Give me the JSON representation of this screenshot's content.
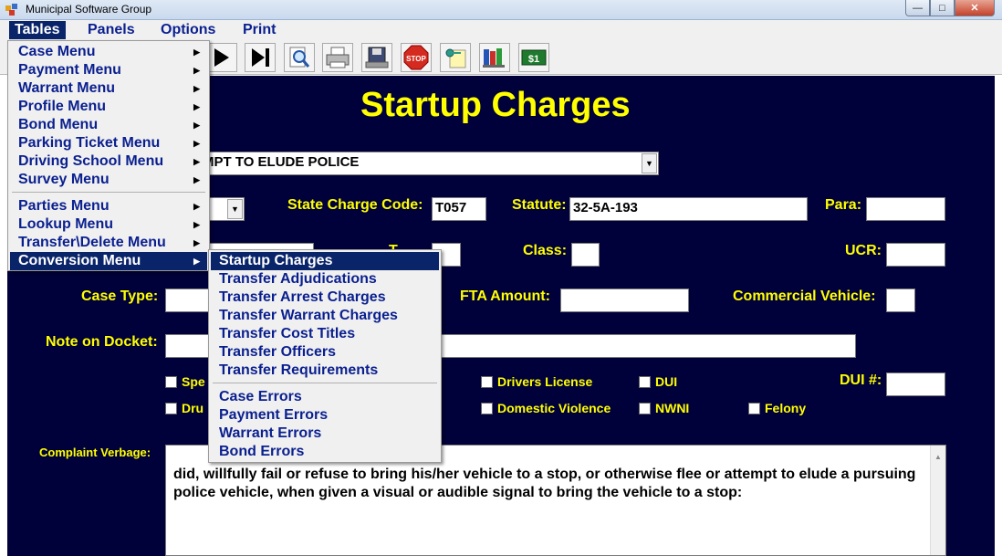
{
  "window": {
    "title": "Municipal Software Group"
  },
  "menubar": {
    "items": [
      "Tables",
      "Panels",
      "Options",
      "Print"
    ]
  },
  "form": {
    "heading": "Startup Charges",
    "charge_desc_value": "MPT TO ELUDE POLICE",
    "state_charge_code_label": "State Charge Code:",
    "state_charge_code_value": "T057",
    "statute_label": "Statute:",
    "statute_value": "32-5A-193",
    "para_label": "Para:",
    "t_label": "T",
    "class_label": "Class:",
    "ucr_label": "UCR:",
    "case_type_label": "Case Type:",
    "fta_amount_label": "FTA Amount:",
    "commercial_vehicle_label": "Commercial Vehicle:",
    "note_on_docket_label": "Note on Docket:",
    "spe_label": "Spe",
    "dru_label": "Dru",
    "drivers_license_label": "Drivers License",
    "dui_label": "DUI",
    "dui_num_label": "DUI #:",
    "domestic_violence_label": "Domestic Violence",
    "nwni_label": "NWNI",
    "felony_label": "Felony",
    "complaint_verbage_label": "Complaint Verbage:",
    "complaint_verbage_value": "did, willfully fail or refuse to bring his/her vehicle to a stop, or otherwise flee or attempt to elude a pursuing police vehicle, when given a visual or audible signal to bring the vehicle to a stop:"
  },
  "tables_menu": {
    "items": [
      "Case Menu",
      "Payment Menu",
      "Warrant Menu",
      "Profile Menu",
      "Bond Menu",
      "Parking Ticket Menu",
      "Driving School Menu",
      "Survey Menu",
      "Parties Menu",
      "Lookup Menu",
      "Transfer\\Delete Menu",
      "Conversion Menu"
    ]
  },
  "conversion_menu": {
    "items": [
      "Startup Charges",
      "Transfer Adjudications",
      "Transfer Arrest Charges",
      "Transfer Warrant Charges",
      "Transfer Cost Titles",
      "Transfer Officers",
      "Transfer Requirements",
      "Case Errors",
      "Payment Errors",
      "Warrant Errors",
      "Bond Errors"
    ]
  },
  "toolbar": {
    "money_label": "$1",
    "stop_label": "STOP"
  },
  "colors": {
    "panel_bg": "#00003a",
    "label_yellow": "#ffff00",
    "menu_text": "#0a1f8f",
    "menu_highlight": "#0a246a"
  }
}
